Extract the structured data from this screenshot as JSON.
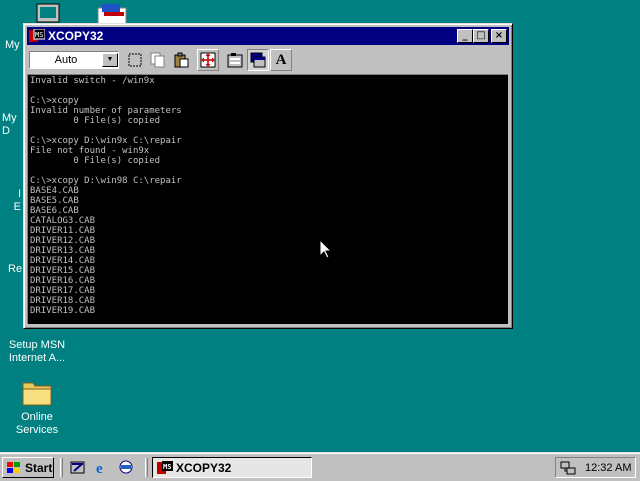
{
  "desktop": {
    "icons": [
      {
        "label": "My",
        "icon": "my-computer-icon"
      },
      {
        "label": "My D",
        "icon": "my-documents-icon"
      },
      {
        "label": "I",
        "icon": "internet-explorer-icon"
      },
      {
        "label": "E",
        "icon": "inbox-icon"
      },
      {
        "label": "Re",
        "icon": "recycle-bin-icon"
      },
      {
        "label": "Setup MSN Internet A...",
        "icon": "msn-setup-icon"
      },
      {
        "label": "Online Services",
        "icon": "folder-icon"
      }
    ]
  },
  "window": {
    "title": "XCOPY32",
    "controls": {
      "minimize": "_",
      "maximize": "□",
      "close": "×"
    },
    "toolbar": {
      "font_size_value": "Auto",
      "tools": [
        "mark-icon",
        "copy-icon",
        "paste-icon",
        "fullscreen-icon",
        "properties-icon",
        "background-icon",
        "font-icon"
      ],
      "font_tool_label": "A"
    },
    "console_lines": [
      "Invalid switch - /win9x",
      "",
      "C:\\>xcopy",
      "Invalid number of parameters",
      "        0 File(s) copied",
      "",
      "C:\\>xcopy D:\\win9x C:\\repair",
      "File not found - win9x",
      "        0 File(s) copied",
      "",
      "C:\\>xcopy D:\\win98 C:\\repair",
      "BASE4.CAB",
      "BASE5.CAB",
      "BASE6.CAB",
      "CATALOG3.CAB",
      "DRIVER11.CAB",
      "DRIVER12.CAB",
      "DRIVER13.CAB",
      "DRIVER14.CAB",
      "DRIVER15.CAB",
      "DRIVER16.CAB",
      "DRIVER17.CAB",
      "DRIVER18.CAB",
      "DRIVER19.CAB"
    ]
  },
  "taskbar": {
    "start_label": "Start",
    "quick_launch": [
      "show-desktop-icon",
      "internet-explorer-icon",
      "channels-icon"
    ],
    "task_label": "XCOPY32",
    "clock": "12:32 AM"
  },
  "colors": {
    "desktop": "#008080",
    "titlebar": "#000080",
    "console_bg": "#000000",
    "console_text": "#c0c0c0"
  }
}
